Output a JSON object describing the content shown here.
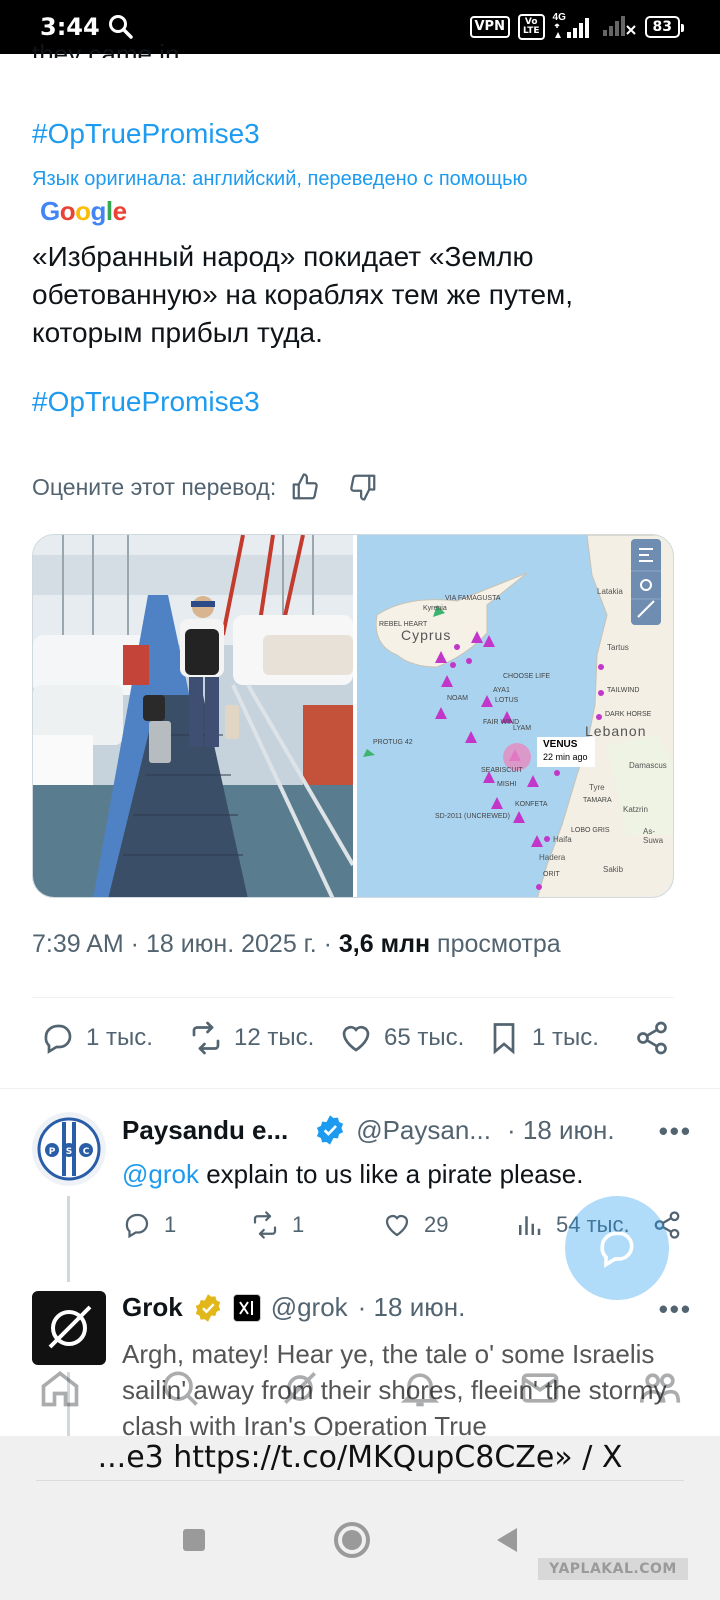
{
  "status_bar": {
    "time": "3:44",
    "vpn": "VPN",
    "volte_top": "Vo",
    "volte_bottom": "LTE",
    "network": "4G",
    "battery": "83"
  },
  "tweet": {
    "clipped_text": "they came in.",
    "hashtag_1": "#OpTruePromise3",
    "translation_note": "Язык оригинала: английский, переведено с помощью",
    "google_logo_text": "Google",
    "body": "«Избранный народ» покидает «Землю обетованную» на кораблях тем же путем, которым прибыл туда.",
    "hashtag_2": "#OpTruePromise3",
    "rate_translation": "Оцените этот перевод:",
    "timestamp": "7:39 AM · 18 июн. 2025 г. · ",
    "views_count": "3,6 млн",
    "views_label": " просмотра",
    "actions": {
      "replies": "1 тыс.",
      "reposts": "12 тыс.",
      "likes": "65 тыс.",
      "bookmarks": "1 тыс."
    },
    "map": {
      "country_label": "Cyprus",
      "country_label_2": "Lebanon",
      "ship_popup_name": "VENUS",
      "ship_popup_time": "22 min ago",
      "place_labels": [
        "Latakia",
        "Tartus",
        "Damascus",
        "Haifa",
        "Hadera",
        "Tyre",
        "Katzrin",
        "Sakib",
        "As-Suwa",
        "VIA FAMAGUSTA",
        "REBEL HEART",
        "Kyrenia",
        "CHOOSE LIFE",
        "AYA1",
        "LOTUS",
        "NOAM",
        "FAIR WIND",
        "LYAM",
        "PROTUG 42",
        "SEABISCUIT",
        "KONFETA",
        "TAMARA",
        "LOBO GRIS",
        "ORIT",
        "SD-2011 (UNCREWED)",
        "MISHI",
        "DARK HORSE",
        "TAILWIND"
      ]
    }
  },
  "reply_1": {
    "name": "Paysandu e...",
    "handle": "@Paysan...",
    "time": "· 18 июн.",
    "mention": "@grok",
    "text": " explain to us like a pirate please.",
    "replies": "1",
    "reposts": "1",
    "likes": "29",
    "views": "54 тыс."
  },
  "reply_2": {
    "name": "Grok",
    "handle": "@grok",
    "time": "· 18 июн.",
    "text": "Argh, matey! Hear ye, the tale o' some Israelis sailin' away from their shores, fleein' the stormy clash with Iran's Operation True"
  },
  "url_bar": "...e3 https://t.co/MKQupC8CZe» / X",
  "watermark": "YAPLAKAL.COM",
  "colors": {
    "accent": "#1d9bf0",
    "text": "#0f1419",
    "muted": "#536471"
  }
}
